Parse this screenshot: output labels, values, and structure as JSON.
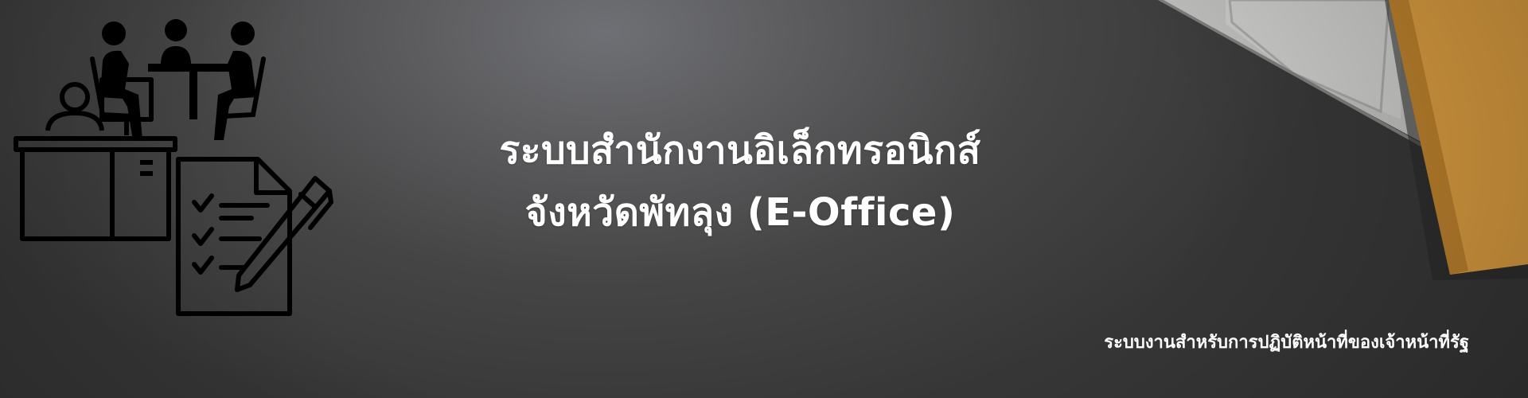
{
  "banner": {
    "title_line1": "ระบบสำนักงานอิเล็กทรอนิกส์",
    "title_line2": "จังหวัดพัทลุง (E-Office)",
    "subtitle": "ระบบงานสำหรับการปฏิบัติหน้าที่ของเจ้าหน้าที่รัฐ"
  },
  "icons": {
    "meeting": "meeting-people-icon",
    "desk": "desk-worker-icon",
    "checklist": "checklist-document-icon",
    "pen": "pen-icon"
  },
  "colors": {
    "text": "#ffffff",
    "background": "#3a3a3a",
    "notebook": "#d89a40",
    "laptop": "#c9c9c7"
  }
}
